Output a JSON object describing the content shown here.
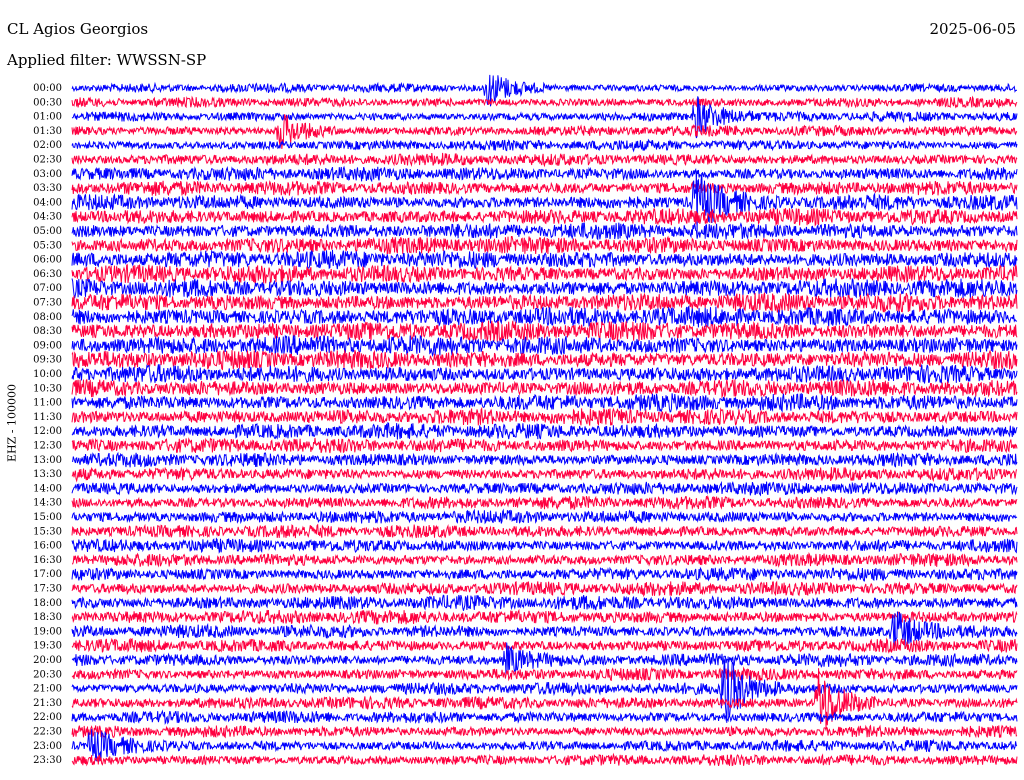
{
  "header": {
    "station": "CL Agios Georgios",
    "filter": "Applied filter: WWSSN-SP",
    "date": "2025-06-05"
  },
  "chart_data": {
    "type": "helicorder",
    "ylabel": "EHZ - 100000",
    "row_labels": [
      "00:00",
      "00:30",
      "01:00",
      "01:30",
      "02:00",
      "02:30",
      "03:00",
      "03:30",
      "04:00",
      "04:30",
      "05:00",
      "05:30",
      "06:00",
      "06:30",
      "07:00",
      "07:30",
      "08:00",
      "08:30",
      "09:00",
      "09:30",
      "10:00",
      "10:30",
      "11:00",
      "11:30",
      "12:00",
      "12:30",
      "13:00",
      "13:30",
      "14:00",
      "14:30",
      "15:00",
      "15:30",
      "16:00",
      "16:30",
      "17:00",
      "17:30",
      "18:00",
      "18:30",
      "19:00",
      "19:30",
      "20:00",
      "20:30",
      "21:00",
      "21:30",
      "22:00",
      "22:30",
      "23:00",
      "23:30"
    ],
    "trace_colors": [
      "#0000ff",
      "#ff0040"
    ],
    "row_activity": [
      0.25,
      0.3,
      0.3,
      0.35,
      0.35,
      0.45,
      0.55,
      0.6,
      0.65,
      0.7,
      0.7,
      0.75,
      0.8,
      0.8,
      0.85,
      0.85,
      0.9,
      0.9,
      0.9,
      0.85,
      0.8,
      0.75,
      0.75,
      0.7,
      0.65,
      0.6,
      0.55,
      0.5,
      0.5,
      0.5,
      0.5,
      0.5,
      0.5,
      0.5,
      0.5,
      0.55,
      0.6,
      0.55,
      0.5,
      0.5,
      0.5,
      0.45,
      0.45,
      0.45,
      0.45,
      0.4,
      0.4,
      0.4
    ],
    "events": [
      {
        "row": 0,
        "x": 0.44,
        "amp": 2.5
      },
      {
        "row": 3,
        "x": 0.22,
        "amp": 2.5
      },
      {
        "row": 2,
        "x": 0.66,
        "amp": 3.0
      },
      {
        "row": 8,
        "x": 0.66,
        "amp": 4.5
      },
      {
        "row": 38,
        "x": 0.87,
        "amp": 3.0
      },
      {
        "row": 40,
        "x": 0.46,
        "amp": 2.0
      },
      {
        "row": 42,
        "x": 0.69,
        "amp": 5.0
      },
      {
        "row": 43,
        "x": 0.79,
        "amp": 5.0
      },
      {
        "row": 46,
        "x": 0.02,
        "amp": 2.5
      }
    ]
  }
}
